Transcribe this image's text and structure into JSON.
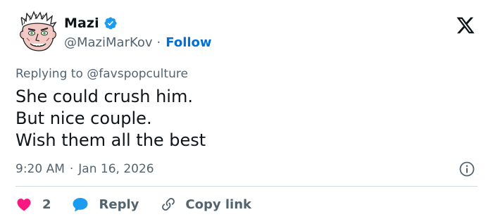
{
  "author": {
    "display_name": "Mazi",
    "handle": "@MaziMarKov",
    "separator": "·",
    "follow_label": "Follow",
    "verified": true,
    "verified_color": "#1d9bf0"
  },
  "reply_context": {
    "prefix": "Replying to ",
    "mention": "@favspopculture"
  },
  "body": {
    "lines": [
      "She could crush him.",
      "But nice couple.",
      "Wish them all the best"
    ]
  },
  "meta": {
    "time": "9:20 AM",
    "separator": "·",
    "date": "Jan 16, 2026"
  },
  "actions": {
    "like_count": "2",
    "like_color": "#f91880",
    "reply_label": "Reply",
    "reply_color": "#1d9bf0",
    "copy_label": "Copy link"
  },
  "icons": {
    "brand": "x-logo-icon",
    "verified": "verified-badge-icon",
    "info": "info-icon",
    "like": "heart-icon",
    "reply": "speech-bubble-icon",
    "copy": "link-icon"
  }
}
